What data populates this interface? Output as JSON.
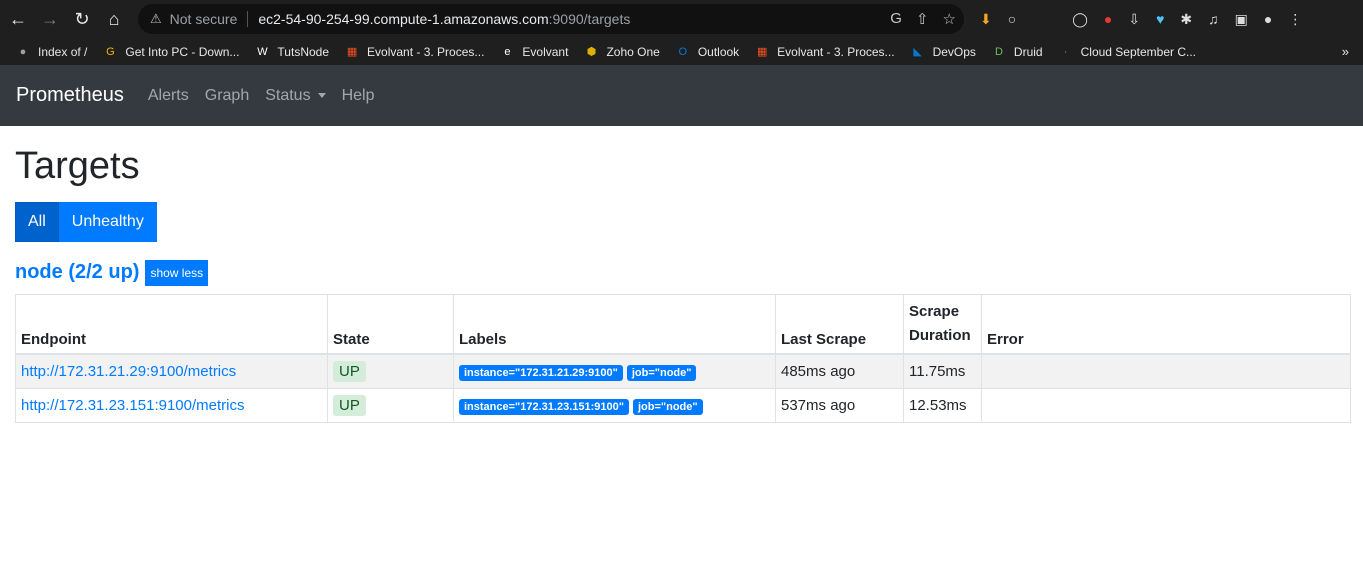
{
  "browser": {
    "not_secure": "Not secure",
    "url_host": "ec2-54-90-254-99.compute-1.amazonaws.com",
    "url_path": ":9090/targets",
    "bookmarks": [
      {
        "label": "Index of /",
        "icon": "globe-icon",
        "color": "#9aa0a6"
      },
      {
        "label": "Get Into PC - Down...",
        "icon": "g-icon",
        "color": "#f4b400"
      },
      {
        "label": "TutsNode",
        "icon": "wordpress-icon",
        "color": "#ffffff"
      },
      {
        "label": "Evolvant - 3. Proces...",
        "icon": "ms-icon",
        "color": "#f25022"
      },
      {
        "label": "Evolvant",
        "icon": "e-icon",
        "color": "#ffffff"
      },
      {
        "label": "Zoho One",
        "icon": "zoho-icon",
        "color": "#e0b000"
      },
      {
        "label": "Outlook",
        "icon": "outlook-icon",
        "color": "#0078d4"
      },
      {
        "label": "Evolvant - 3. Proces...",
        "icon": "ms-icon",
        "color": "#f25022"
      },
      {
        "label": "DevOps",
        "icon": "devops-icon",
        "color": "#0078d4"
      },
      {
        "label": "Druid",
        "icon": "druid-icon",
        "color": "#6dbf5a"
      },
      {
        "label": "Cloud September C...",
        "icon": "doc-icon",
        "color": "#888888"
      }
    ],
    "bookmarks_more": "»"
  },
  "navbar": {
    "brand": "Prometheus",
    "links": [
      "Alerts",
      "Graph",
      "Status",
      "Help"
    ]
  },
  "page": {
    "title": "Targets",
    "filter_all": "All",
    "filter_unhealthy": "Unhealthy",
    "job_title": "node (2/2 up)",
    "toggle_label": "show less"
  },
  "table": {
    "headers": [
      "Endpoint",
      "State",
      "Labels",
      "Last Scrape",
      "Scrape\nDuration",
      "Error"
    ],
    "rows": [
      {
        "endpoint": "http://172.31.21.29:9100/metrics",
        "state": "UP",
        "labels": [
          "instance=\"172.31.21.29:9100\"",
          "job=\"node\""
        ],
        "last_scrape": "485ms ago",
        "duration": "11.75ms",
        "error": ""
      },
      {
        "endpoint": "http://172.31.23.151:9100/metrics",
        "state": "UP",
        "labels": [
          "instance=\"172.31.23.151:9100\"",
          "job=\"node\""
        ],
        "last_scrape": "537ms ago",
        "duration": "12.53ms",
        "error": ""
      }
    ]
  },
  "colors": {
    "primary": "#007bff",
    "navbar": "#343a40",
    "up_bg": "#d4edda",
    "up_text": "#155724"
  }
}
